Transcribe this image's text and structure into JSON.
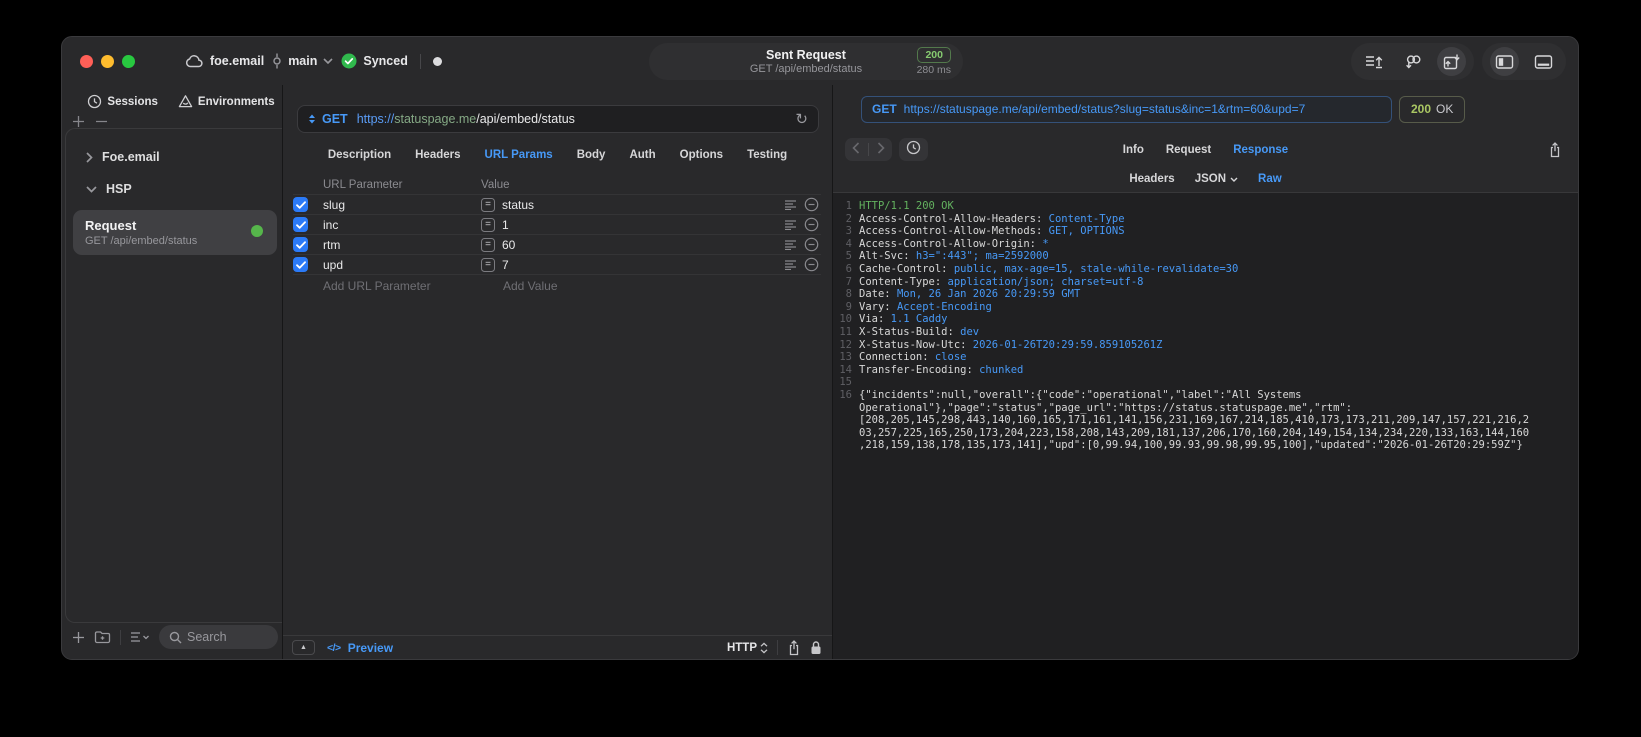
{
  "titlebar": {
    "project": "foe.email",
    "branch": "main",
    "sync_status": "Synced",
    "request_pill": {
      "title": "Sent Request",
      "subtitle": "GET /api/embed/status",
      "status_code": "200",
      "duration": "280 ms"
    }
  },
  "sidebar": {
    "tabs": [
      {
        "label": "Sessions"
      },
      {
        "label": "Environments"
      }
    ],
    "tree": [
      {
        "label": "Foe.email",
        "expanded": false
      },
      {
        "label": "HSP",
        "expanded": true
      }
    ],
    "request_item": {
      "title": "Request",
      "subtitle": "GET /api/embed/status"
    },
    "search_placeholder": "Search"
  },
  "request_panel": {
    "method": "GET",
    "url": {
      "scheme": "https://",
      "host": "statuspage.me",
      "path": "/api/embed/status"
    },
    "tabs": [
      "Description",
      "Headers",
      "URL Params",
      "Body",
      "Auth",
      "Options",
      "Testing"
    ],
    "active_tab": "URL Params",
    "params": {
      "columns": [
        "URL Parameter",
        "Value"
      ],
      "rows": [
        {
          "name": "slug",
          "value": "status",
          "enabled": true
        },
        {
          "name": "inc",
          "value": "1",
          "enabled": true
        },
        {
          "name": "rtm",
          "value": "60",
          "enabled": true
        },
        {
          "name": "upd",
          "value": "7",
          "enabled": true
        }
      ],
      "add_parameter_placeholder": "Add URL Parameter",
      "add_value_placeholder": "Add Value"
    },
    "footer": {
      "preview_label": "Preview",
      "protocol_selector": "HTTP"
    }
  },
  "response_panel": {
    "request_line": {
      "method": "GET",
      "url": "https://statuspage.me/api/embed/status?slug=status&inc=1&rtm=60&upd=7"
    },
    "status_badge": {
      "code": "200",
      "text": "OK"
    },
    "tabs": [
      "Info",
      "Request",
      "Response"
    ],
    "active_tab": "Response",
    "subtabs": [
      "Headers",
      "JSON",
      "Raw"
    ],
    "active_subtab": "Raw",
    "raw": {
      "status_line": "HTTP/1.1 200 OK",
      "headers": [
        {
          "name": "Access-Control-Allow-Headers",
          "value": "Content-Type"
        },
        {
          "name": "Access-Control-Allow-Methods",
          "value": "GET, OPTIONS"
        },
        {
          "name": "Access-Control-Allow-Origin",
          "value": "*"
        },
        {
          "name": "Alt-Svc",
          "value": "h3=\":443\"; ma=2592000"
        },
        {
          "name": "Cache-Control",
          "value": "public, max-age=15, stale-while-revalidate=30"
        },
        {
          "name": "Content-Type",
          "value": "application/json; charset=utf-8"
        },
        {
          "name": "Date",
          "value": "Mon, 26 Jan 2026 20:29:59 GMT"
        },
        {
          "name": "Vary",
          "value": "Accept-Encoding"
        },
        {
          "name": "Via",
          "value": "1.1 Caddy"
        },
        {
          "name": "X-Status-Build",
          "value": "dev"
        },
        {
          "name": "X-Status-Now-Utc",
          "value": "2026-01-26T20:29:59.859105261Z"
        },
        {
          "name": "Connection",
          "value": "close"
        },
        {
          "name": "Transfer-Encoding",
          "value": "chunked"
        }
      ],
      "body": "{\"incidents\":null,\"overall\":{\"code\":\"operational\",\"label\":\"All Systems Operational\"},\"page\":\"status\",\"page_url\":\"https://status.statuspage.me\",\"rtm\":[208,205,145,298,443,140,160,165,171,161,141,156,231,169,167,214,185,410,173,173,211,209,147,157,221,216,203,257,225,165,250,173,204,223,158,208,143,209,181,137,206,170,160,204,149,154,134,234,220,133,163,144,160,218,159,138,178,135,173,141],\"upd\":[0,99.94,100,99.93,99.98,99.95,100],\"updated\":\"2026-01-26T20:29:59Z\"}"
    }
  },
  "colors": {
    "accent_blue": "#4799f7",
    "sync_green": "#30b94d",
    "badge_green": "#86ca70",
    "response_status_green": "#aac763",
    "raw_status_green": "#63b25f",
    "url_host_green": "#85a985",
    "checkbox_blue": "#2b7af7"
  }
}
